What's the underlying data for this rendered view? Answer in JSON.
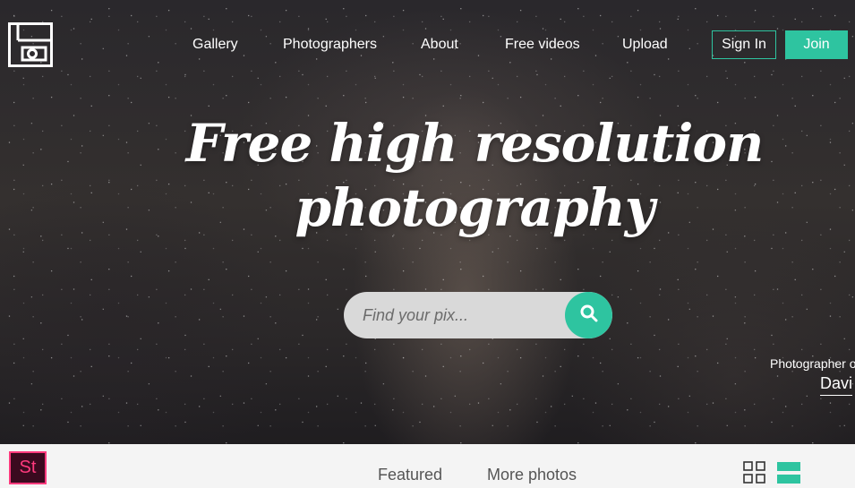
{
  "header": {
    "logo_icon": "camera-logo-icon",
    "nav": [
      "Gallery",
      "Photographers",
      "About",
      "Free videos",
      "Upload"
    ],
    "sign_in_label": "Sign In",
    "join_label": "Join"
  },
  "hero": {
    "headline_line1": "Free high resolution",
    "headline_line2": "photography",
    "search": {
      "placeholder": "Find your pix...",
      "button_icon": "search-icon"
    },
    "credit_label": "Photographer o",
    "credit_name": "Davi"
  },
  "bottom_bar": {
    "app_badge": "St",
    "tabs": [
      "Featured",
      "More photos"
    ],
    "view_icons": [
      "grid-view-icon",
      "list-view-icon"
    ]
  },
  "colors": {
    "accent": "#2ec4a0",
    "badge_border": "#ff3a7d",
    "badge_bg": "#3a0a1f"
  }
}
